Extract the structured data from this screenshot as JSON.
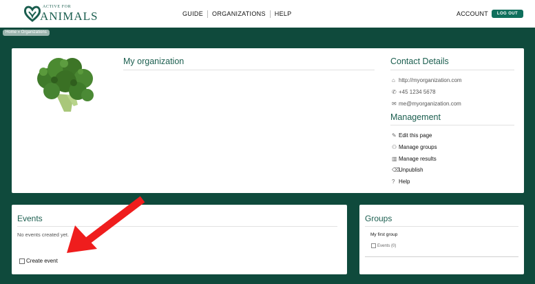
{
  "header": {
    "logo_small": "ACTIVE FOR",
    "logo_big": "ANIMALS",
    "nav": [
      "GUIDE",
      "ORGANIZATIONS",
      "HELP"
    ],
    "account": "ACCOUNT",
    "logout": "LOG OUT"
  },
  "breadcrumb": "Home » Organizations",
  "organization": {
    "name": "My organization"
  },
  "contact": {
    "title": "Contact Details",
    "website": "http://myorganization.com",
    "phone": "+45 1234 5678",
    "email": "me@myorganization.com"
  },
  "management": {
    "title": "Management",
    "items": [
      "Edit this page",
      "Manage groups",
      "Manage results",
      "Unpublish",
      "Help"
    ]
  },
  "events": {
    "title": "Events",
    "empty_text": "No events created yet.",
    "create_label": "Create event"
  },
  "groups": {
    "title": "Groups",
    "items": [
      {
        "name": "My first group",
        "events_label": "Events (0)"
      }
    ]
  },
  "colors": {
    "background": "#0f4a3c",
    "brand": "#1b5e4f",
    "button": "#0f6f5c",
    "annotation_arrow": "#ef1d1d"
  },
  "icons": {
    "website": "home-icon",
    "phone": "phone-icon",
    "email": "mail-icon",
    "edit": "pencil-icon",
    "groups": "people-icon",
    "results": "chart-icon",
    "unpublish": "trash-icon",
    "help": "help-circle-icon"
  }
}
